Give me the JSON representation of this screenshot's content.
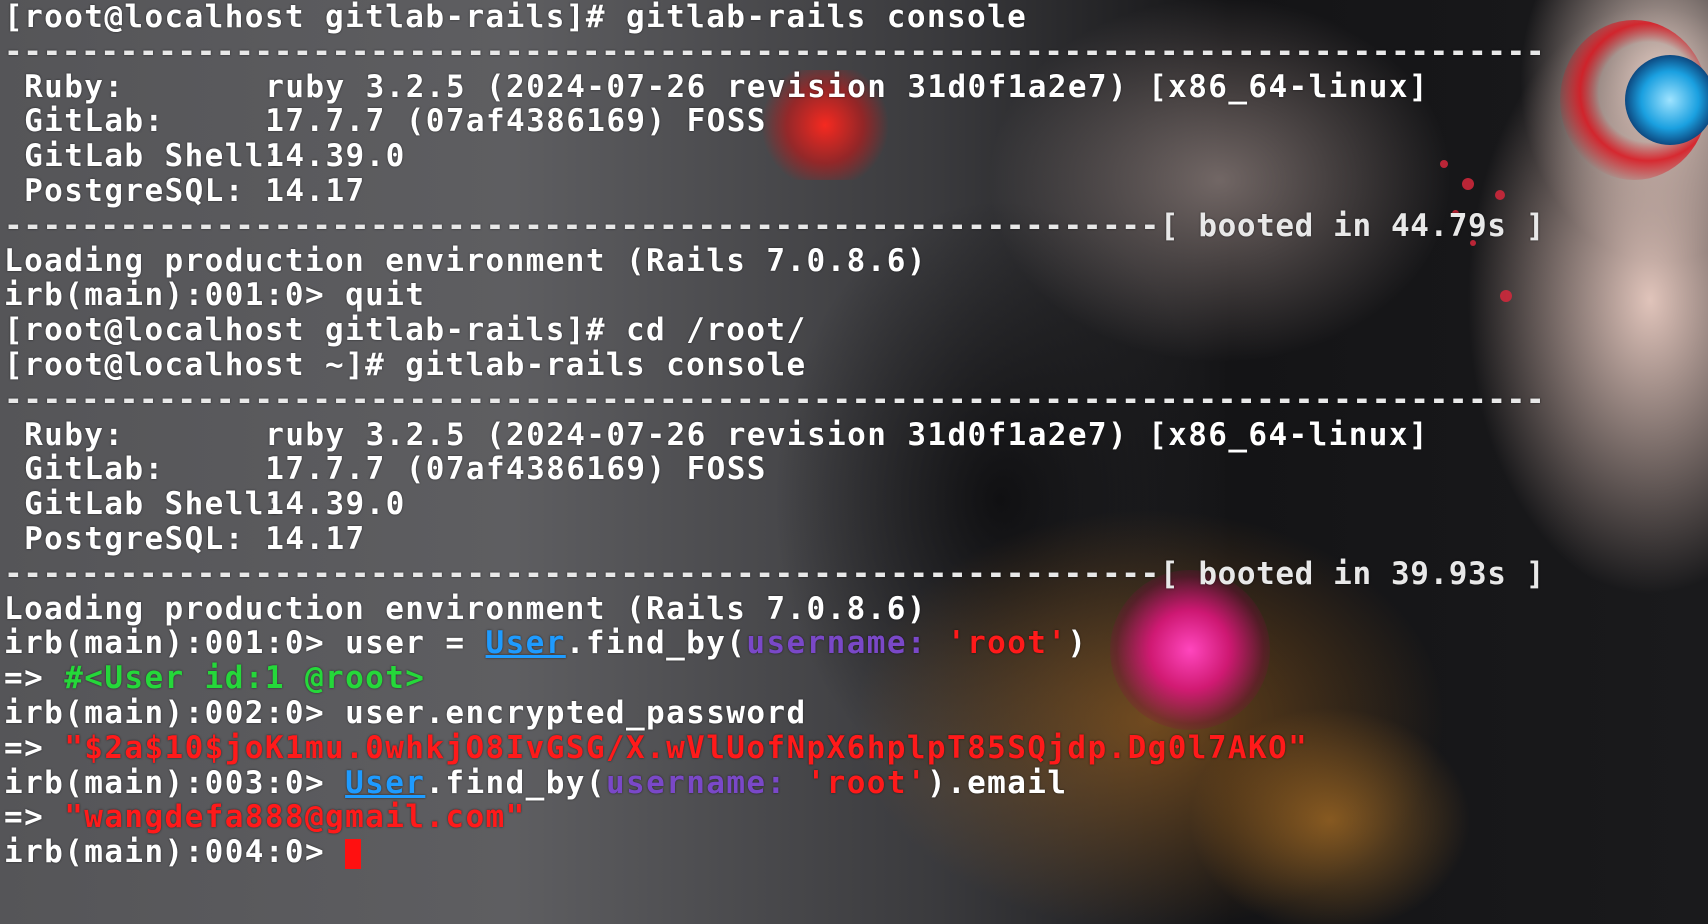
{
  "terminal": {
    "lines": [
      {
        "type": "text",
        "text": "[root@localhost gitlab-rails]# gitlab-rails console"
      },
      {
        "type": "rule",
        "text": "--------------------------------------------------------------------------------"
      },
      {
        "type": "info",
        "label": " Ruby:",
        "value": "ruby 3.2.5 (2024-07-26 revision 31d0f1a2e7) [x86_64-linux]"
      },
      {
        "type": "info",
        "label": " GitLab:",
        "value": "17.7.7 (07af4386169) FOSS"
      },
      {
        "type": "info",
        "label": " GitLab Shell:",
        "value": "14.39.0"
      },
      {
        "type": "info",
        "label": " PostgreSQL:",
        "value": "14.17"
      },
      {
        "type": "rule",
        "text": "------------------------------------------------------------[ booted in 44.79s ]"
      },
      {
        "type": "text",
        "text": "Loading production environment (Rails 7.0.8.6)"
      },
      {
        "type": "text",
        "text": "irb(main):001:0> quit"
      },
      {
        "type": "text",
        "text": "[root@localhost gitlab-rails]# cd /root/"
      },
      {
        "type": "text",
        "text": "[root@localhost ~]# gitlab-rails console"
      },
      {
        "type": "rule",
        "text": "--------------------------------------------------------------------------------"
      },
      {
        "type": "info",
        "label": " Ruby:",
        "value": "ruby 3.2.5 (2024-07-26 revision 31d0f1a2e7) [x86_64-linux]"
      },
      {
        "type": "info",
        "label": " GitLab:",
        "value": "17.7.7 (07af4386169) FOSS"
      },
      {
        "type": "info",
        "label": " GitLab Shell:",
        "value": "14.39.0"
      },
      {
        "type": "info",
        "label": " PostgreSQL:",
        "value": "14.17"
      },
      {
        "type": "rule",
        "text": "------------------------------------------------------------[ booted in 39.93s ]"
      },
      {
        "type": "text",
        "text": "Loading production environment (Rails 7.0.8.6)"
      },
      {
        "type": "code",
        "segments": [
          {
            "cls": "",
            "text": "irb(main):001:0> user = "
          },
          {
            "cls": "cls",
            "text": "User"
          },
          {
            "cls": "",
            "text": ".find_by("
          },
          {
            "cls": "sym",
            "text": "username:"
          },
          {
            "cls": "",
            "text": " "
          },
          {
            "cls": "str",
            "text": "'root'"
          },
          {
            "cls": "",
            "text": ")"
          }
        ]
      },
      {
        "type": "code",
        "segments": [
          {
            "cls": "",
            "text": "=> "
          },
          {
            "cls": "obj",
            "text": "#<User id:1 @root>"
          }
        ]
      },
      {
        "type": "text",
        "text": "irb(main):002:0> user.encrypted_password"
      },
      {
        "type": "code",
        "segments": [
          {
            "cls": "",
            "text": "=> "
          },
          {
            "cls": "str",
            "text": "\"$2a$10$joK1mu.0whkjO8IvGSG/X.wVlUofNpX6hplpT85SQjdp.Dg0l7AKO\""
          }
        ]
      },
      {
        "type": "code",
        "segments": [
          {
            "cls": "",
            "text": "irb(main):003:0> "
          },
          {
            "cls": "cls",
            "text": "User"
          },
          {
            "cls": "",
            "text": ".find_by("
          },
          {
            "cls": "sym",
            "text": "username:"
          },
          {
            "cls": "",
            "text": " "
          },
          {
            "cls": "str",
            "text": "'root'"
          },
          {
            "cls": "",
            "text": ").email"
          }
        ]
      },
      {
        "type": "code",
        "segments": [
          {
            "cls": "",
            "text": "=> "
          },
          {
            "cls": "str",
            "text": "\"wangdefa888@gmail.com\""
          }
        ]
      },
      {
        "type": "prompt",
        "text": "irb(main):004:0> "
      }
    ]
  },
  "colors": {
    "default_text": "#ffffff",
    "class_name": "#1e9bff",
    "symbol": "#7a48c8",
    "string": "#ff1a1a",
    "object": "#25d83a",
    "cursor": "#ff1010"
  }
}
